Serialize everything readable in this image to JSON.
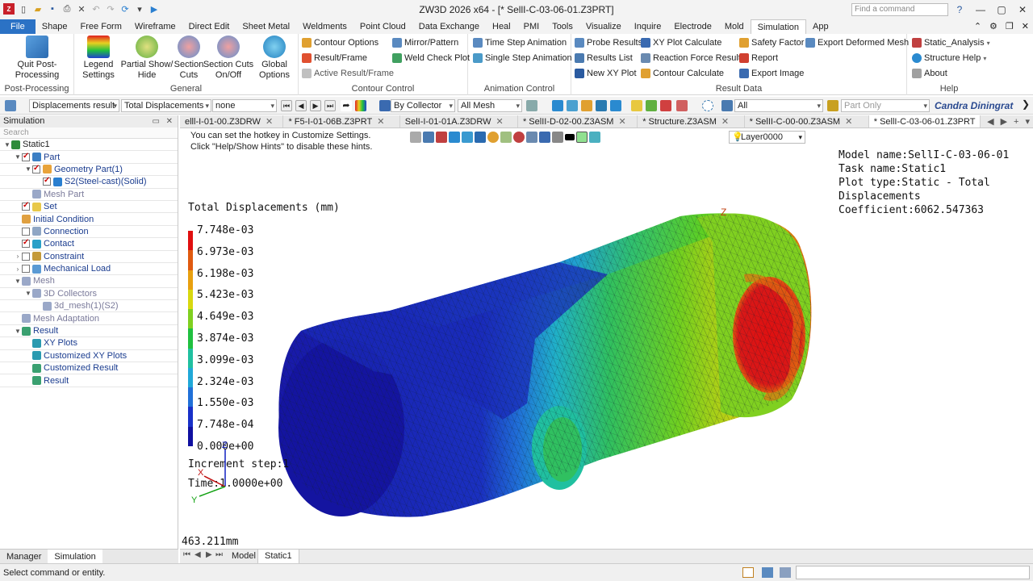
{
  "app_title": "ZW3D 2026 x64 - [* SellI-C-03-06-01.Z3PRT]",
  "find_placeholder": "Find a command",
  "menu": [
    "File",
    "Shape",
    "Free Form",
    "Wireframe",
    "Direct Edit",
    "Sheet Metal",
    "Weldments",
    "Point Cloud",
    "Data Exchange",
    "Heal",
    "PMI",
    "Tools",
    "Visualize",
    "Inquire",
    "Electrode",
    "Mold",
    "Simulation",
    "App"
  ],
  "menu_active": "Simulation",
  "ribbon": {
    "post_processing": {
      "label": "Post-Processing",
      "quit": "Quit Post-\nProcessing"
    },
    "general": {
      "label": "General",
      "legend": "Legend\nSettings",
      "partial": "Partial Show/\nHide",
      "section": "Section\nCuts",
      "section_onoff": "Section Cuts\nOn/Off",
      "global": "Global\nOptions"
    },
    "contour_control": {
      "label": "Contour Control",
      "items": [
        "Contour Options",
        "Result/Frame",
        "Active Result/Frame",
        "Mirror/Pattern",
        "Weld Check Plot"
      ]
    },
    "animation_control": {
      "label": "Animation Control",
      "items": [
        "Time Step Animation",
        "Single Step Animation"
      ]
    },
    "result_data": {
      "label": "Result Data",
      "items": [
        "Probe Results",
        "Results List",
        "New XY Plot",
        "XY Plot Calculate",
        "Reaction Force Results",
        "Contour Calculate",
        "Safety Factor",
        "Report",
        "Export Image",
        "Export Deformed Mesh"
      ]
    },
    "help": {
      "label": "Help",
      "items": [
        "Static_Analysis",
        "Structure Help",
        "About"
      ]
    }
  },
  "toolbar2": {
    "result": "Displacements result",
    "component": "Total Displacements",
    "option": "none",
    "collector": "By Collector",
    "mesh": "All Mesh",
    "filter": "All",
    "part_only": "Part Only",
    "watermark": "Candra Diningrat"
  },
  "left_panel": {
    "title": "Simulation",
    "search": "Search",
    "tree": [
      {
        "label": "Static1",
        "level": 0,
        "arrow": "▼",
        "check": null,
        "color": "#2e8b3a",
        "style": ""
      },
      {
        "label": "Part",
        "level": 1,
        "arrow": "▼",
        "check": "on",
        "color": "#3b7fc4",
        "style": "blue"
      },
      {
        "label": "Geometry Part(1)",
        "level": 2,
        "arrow": "▼",
        "check": "on",
        "color": "#e8a33a",
        "style": "blue"
      },
      {
        "label": "S2(Steel-cast)(Solid)",
        "level": 3,
        "arrow": "",
        "check": "on",
        "color": "#2a7fd0",
        "style": "blue"
      },
      {
        "label": "Mesh Part",
        "level": 2,
        "arrow": "",
        "check": null,
        "color": "#9aa8c8",
        "style": "gray"
      },
      {
        "label": "Set",
        "level": 1,
        "arrow": "",
        "check": "on",
        "color": "#e8c84a",
        "style": "blue"
      },
      {
        "label": "Initial Condition",
        "level": 1,
        "arrow": "",
        "check": null,
        "color": "#e0a040",
        "style": "blue"
      },
      {
        "label": "Connection",
        "level": 1,
        "arrow": "",
        "check": "off",
        "color": "#8fa6c4",
        "style": "blue"
      },
      {
        "label": "Contact",
        "level": 1,
        "arrow": "",
        "check": "on",
        "color": "#2aa0c8",
        "style": "blue"
      },
      {
        "label": "Constraint",
        "level": 1,
        "arrow": "›",
        "check": "off",
        "color": "#c49a3a",
        "style": "blue"
      },
      {
        "label": "Mechanical Load",
        "level": 1,
        "arrow": "›",
        "check": "off",
        "color": "#5a9ad4",
        "style": "blue"
      },
      {
        "label": "Mesh",
        "level": 1,
        "arrow": "▼",
        "check": null,
        "color": "#9aa8c8",
        "style": "gray"
      },
      {
        "label": "3D Collectors",
        "level": 2,
        "arrow": "▼",
        "check": null,
        "color": "#9aa8c8",
        "style": "gray"
      },
      {
        "label": "3d_mesh(1)(S2)",
        "level": 3,
        "arrow": "",
        "check": null,
        "color": "#9aa8c8",
        "style": "gray"
      },
      {
        "label": "Mesh Adaptation",
        "level": 1,
        "arrow": "",
        "check": null,
        "color": "#9aa8c8",
        "style": "gray"
      },
      {
        "label": "Result",
        "level": 1,
        "arrow": "▼",
        "check": null,
        "color": "#3aa070",
        "style": "blue"
      },
      {
        "label": "XY Plots",
        "level": 2,
        "arrow": "",
        "check": null,
        "color": "#2a9ab0",
        "style": "blue"
      },
      {
        "label": "Customized XY Plots",
        "level": 2,
        "arrow": "",
        "check": null,
        "color": "#2a9ab0",
        "style": "blue"
      },
      {
        "label": "Customized Result",
        "level": 2,
        "arrow": "",
        "check": null,
        "color": "#3aa070",
        "style": "blue"
      },
      {
        "label": "Result",
        "level": 2,
        "arrow": "",
        "check": null,
        "color": "#3aa070",
        "style": "blue"
      }
    ],
    "tabs": [
      "Manager",
      "Simulation"
    ]
  },
  "doc_tabs": [
    "elll-I-01-00.Z3DRW",
    "* F5-I-01-06B.Z3PRT",
    "SelI-I-01-01A.Z3DRW",
    "* SelII-D-02-00.Z3ASM",
    "* Structure.Z3ASM",
    "* SelII-C-00-00.Z3ASM",
    "* SellI-C-03-06-01.Z3PRT"
  ],
  "viewport": {
    "hint1": "You can set the hotkey in Customize Settings.",
    "hint2": "Click \"Help/Show Hints\" to disable these hints.",
    "layer": "Layer0000",
    "model_info": [
      "Model name:SellI-C-03-06-01",
      "Task name:Static1",
      "Plot type:Static - Total Displacements",
      "Coefficient:6062.547363"
    ],
    "legend_title": "Total Displacements (mm)",
    "legend_values": [
      "7.748e-03",
      "6.973e-03",
      "6.198e-03",
      "5.423e-03",
      "4.649e-03",
      "3.874e-03",
      "3.099e-03",
      "2.324e-03",
      "1.550e-03",
      "7.748e-04",
      "0.000e+00"
    ],
    "legend_colors": [
      "#e01010",
      "#e05a10",
      "#e8a010",
      "#d8d810",
      "#80d020",
      "#20c040",
      "#20c0a0",
      "#20a8d8",
      "#2070d8",
      "#1830c8",
      "#1010a0"
    ],
    "increment": "Increment step:1",
    "time": "Time:1.0000e+00",
    "scale": "463.211mm",
    "axis_z": "Z",
    "axis_x": "X",
    "axis_y": "Y"
  },
  "bottom_tabs": [
    "Model",
    "Static1"
  ],
  "status": "Select command or entity."
}
